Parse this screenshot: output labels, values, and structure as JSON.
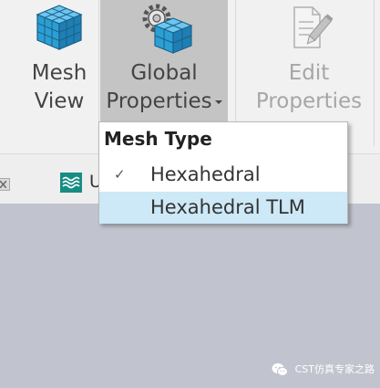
{
  "ribbon": {
    "mesh_view": {
      "line1": "Mesh",
      "line2": "View",
      "icon": "mesh-cube-icon"
    },
    "global_properties": {
      "line1": "Global",
      "line2": "Properties",
      "icon": "gear-mesh-icon"
    },
    "edit_properties": {
      "line1": "Edit",
      "line2": "Properties",
      "icon": "pencil-document-icon",
      "disabled": true
    }
  },
  "menu": {
    "header": "Mesh Type",
    "items": [
      {
        "label": "Hexahedral",
        "checked": true,
        "check_glyph": "✓"
      },
      {
        "label": "Hexahedral TLM",
        "checked": false,
        "highlighted": true
      }
    ]
  },
  "tab": {
    "label": "U",
    "icon": "wave-tab-icon"
  },
  "watermark": {
    "text": "CST仿真专家之路"
  },
  "colors": {
    "ribbon_bg": "#f1f1f1",
    "active_button_bg": "#c4c4c4",
    "menu_highlight": "#cde8f7",
    "workspace_bg": "#c1c4ce",
    "cube_blue": "#2b9fd3",
    "tab_icon_green": "#178c82"
  }
}
